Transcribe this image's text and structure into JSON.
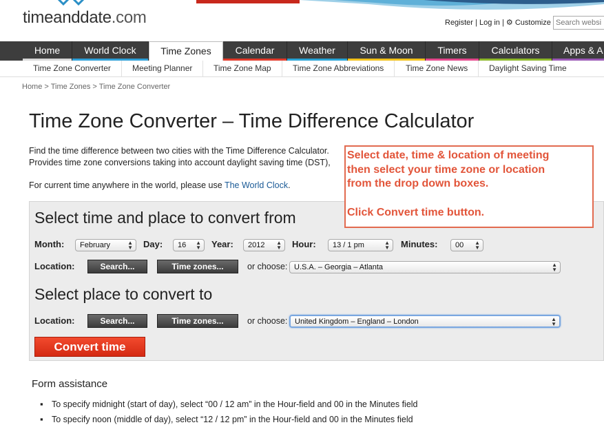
{
  "header": {
    "logo_main": "timeanddate",
    "logo_domain": ".com",
    "links": {
      "register": "Register",
      "sep1": "|",
      "login": "Log in",
      "sep2": "|",
      "customize": "Customize"
    },
    "search_placeholder": "Search websi"
  },
  "mainnav": [
    {
      "label": "Home",
      "color": "#d9d9d9"
    },
    {
      "label": "World Clock",
      "color": "#30a0d8"
    },
    {
      "label": "Time Zones",
      "color": "#ffffff"
    },
    {
      "label": "Calendar",
      "color": "#e23b2c"
    },
    {
      "label": "Weather",
      "color": "#2aa4d6"
    },
    {
      "label": "Sun & Moon",
      "color": "#f2c21b"
    },
    {
      "label": "Timers",
      "color": "#e5498d"
    },
    {
      "label": "Calculators",
      "color": "#8db82b"
    },
    {
      "label": "Apps & A",
      "color": "#9b59b6"
    }
  ],
  "subnav": [
    "Time Zone Converter",
    "Meeting Planner",
    "Time Zone Map",
    "Time Zone Abbreviations",
    "Time Zone News",
    "Daylight Saving Time"
  ],
  "breadcrumb": {
    "home": "Home",
    "sep1": " > ",
    "zones": "Time Zones",
    "sep2": " > ",
    "current": "Time Zone Converter"
  },
  "page_title": "Time Zone Converter – Time Difference Calculator",
  "intro": {
    "line1": "Find the time difference between two cities with the Time Difference Calculator.",
    "line2": "Provides time zone conversions taking into account daylight saving time (DST),",
    "line3_pre": "For current time anywhere in the world, please use ",
    "line3_link": "The World Clock",
    "line3_post": "."
  },
  "callout": {
    "line1": "Select date, time & location of meeting",
    "line2": "then select your time zone or location",
    "line3": "from the drop down boxes.",
    "line4": "Click Convert time button."
  },
  "from": {
    "title": "Select time and place to convert from",
    "month_label": "Month:",
    "month_value": "February",
    "day_label": "Day:",
    "day_value": "16",
    "year_label": "Year:",
    "year_value": "2012",
    "hour_label": "Hour:",
    "hour_value": "13 / 1 pm",
    "minutes_label": "Minutes:",
    "minutes_value": "00",
    "location_label": "Location:",
    "search_btn": "Search...",
    "zones_btn": "Time zones...",
    "or_choose": "or choose:",
    "location_value": "U.S.A. – Georgia – Atlanta"
  },
  "to": {
    "title": "Select place to convert to",
    "location_label": "Location:",
    "search_btn": "Search...",
    "zones_btn": "Time zones...",
    "or_choose": "or choose:",
    "location_value": "United Kingdom – England – London"
  },
  "convert_btn": "Convert time",
  "assist": {
    "title": "Form assistance",
    "items": [
      "To specify midnight (start of day), select “00 / 12 am” in the Hour-field and 00 in the Minutes field",
      "To specify noon (middle of day), select “12 / 12 pm” in the Hour-field and 00 in the Minutes field"
    ]
  },
  "colors": {
    "callout": "#e2553a",
    "convert": "#e0351d",
    "link": "#1a5a96",
    "nav_bg": "#3d3d3d"
  }
}
